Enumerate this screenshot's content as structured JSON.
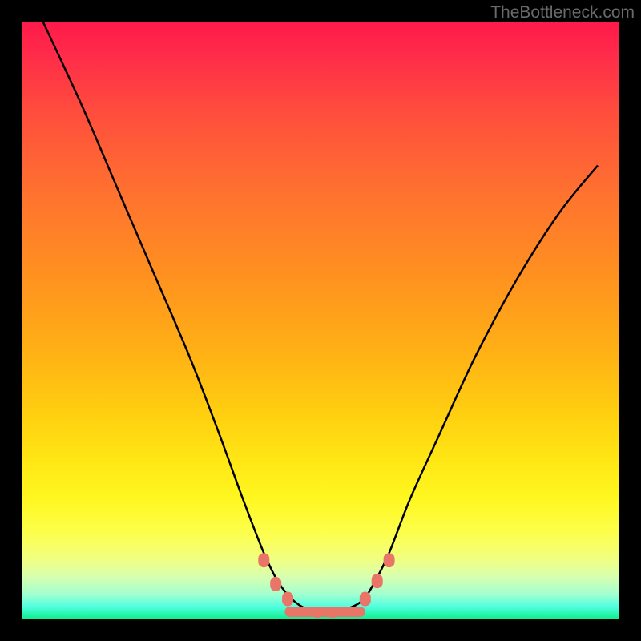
{
  "watermark": "TheBottleneck.com",
  "chart_data": {
    "type": "line",
    "title": "",
    "xlabel": "",
    "ylabel": "",
    "xlim": [
      0,
      1
    ],
    "ylim": [
      0,
      1
    ],
    "background": {
      "type": "vertical-gradient",
      "stops": [
        {
          "pos": 0.0,
          "color": "#ff1a4a"
        },
        {
          "pos": 0.15,
          "color": "#ff4d3d"
        },
        {
          "pos": 0.42,
          "color": "#ff9020"
        },
        {
          "pos": 0.66,
          "color": "#ffd010"
        },
        {
          "pos": 0.86,
          "color": "#fcff50"
        },
        {
          "pos": 0.96,
          "color": "#a0ffd0"
        },
        {
          "pos": 1.0,
          "color": "#10f090"
        }
      ]
    },
    "series": [
      {
        "name": "bottleneck-curve",
        "color": "#000000",
        "x": [
          0.035,
          0.1,
          0.16,
          0.22,
          0.28,
          0.33,
          0.37,
          0.405,
          0.43,
          0.455,
          0.48,
          0.51,
          0.54,
          0.57,
          0.59,
          0.615,
          0.65,
          0.7,
          0.76,
          0.83,
          0.9,
          0.965
        ],
        "y": [
          1.0,
          0.86,
          0.72,
          0.58,
          0.44,
          0.31,
          0.2,
          0.11,
          0.06,
          0.03,
          0.015,
          0.012,
          0.015,
          0.03,
          0.06,
          0.11,
          0.2,
          0.31,
          0.44,
          0.57,
          0.68,
          0.76
        ]
      }
    ],
    "markers": {
      "name": "highlight-dots",
      "color": "#e87568",
      "points": [
        {
          "x": 0.405,
          "y_top": 0.11
        },
        {
          "x": 0.425,
          "y_top": 0.07
        },
        {
          "x": 0.445,
          "y_top": 0.045
        },
        {
          "x": 0.47,
          "y_top": 0.018
        },
        {
          "x": 0.495,
          "y_top": 0.012
        },
        {
          "x": 0.52,
          "y_top": 0.012
        },
        {
          "x": 0.545,
          "y_top": 0.018
        },
        {
          "x": 0.575,
          "y_top": 0.045
        },
        {
          "x": 0.595,
          "y_top": 0.075
        },
        {
          "x": 0.615,
          "y_top": 0.11
        }
      ]
    }
  }
}
